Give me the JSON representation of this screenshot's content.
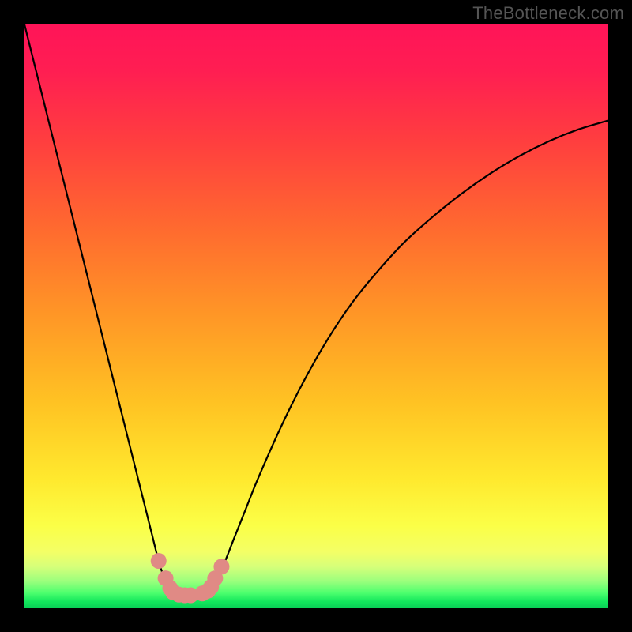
{
  "watermark": "TheBottleneck.com",
  "chart_data": {
    "type": "line",
    "title": "",
    "xlabel": "",
    "ylabel": "",
    "xlim": [
      0,
      100
    ],
    "ylim": [
      0,
      100
    ],
    "series": [
      {
        "name": "bottleneck-curve",
        "x": [
          0.0,
          2.0,
          4.0,
          6.0,
          8.0,
          10.0,
          12.0,
          14.0,
          16.0,
          18.0,
          19.0,
          20.0,
          21.0,
          22.0,
          23.0,
          24.0,
          25.0,
          26.0,
          27.0,
          28.0,
          29.0,
          30.0,
          32.0,
          34.0,
          36.0,
          38.0,
          40.0,
          44.0,
          48.0,
          52.0,
          56.0,
          60.0,
          65.0,
          70.0,
          75.0,
          80.0,
          85.0,
          90.0,
          95.0,
          100.0
        ],
        "y": [
          100.0,
          92.0,
          84.0,
          76.0,
          68.0,
          60.0,
          52.0,
          44.0,
          36.0,
          28.0,
          24.0,
          20.0,
          16.0,
          12.0,
          8.0,
          5.0,
          3.0,
          2.3,
          2.0,
          2.0,
          2.0,
          2.0,
          3.5,
          7.0,
          12.0,
          17.0,
          22.0,
          31.0,
          39.0,
          46.0,
          52.0,
          57.0,
          62.5,
          67.0,
          71.0,
          74.5,
          77.5,
          80.0,
          82.0,
          83.5
        ]
      }
    ],
    "markers": {
      "name": "highlight-dots",
      "x": [
        23.0,
        24.2,
        25.0,
        25.5,
        26.5,
        27.5,
        28.5,
        30.5,
        31.5,
        32.0,
        32.7,
        33.8
      ],
      "y": [
        8.0,
        5.0,
        3.3,
        2.6,
        2.2,
        2.1,
        2.1,
        2.4,
        2.9,
        3.5,
        5.0,
        7.0
      ],
      "color": "#e08a85",
      "radius": 10
    },
    "gradient_stops": [
      {
        "offset": 0.0,
        "color": "#ff1458"
      },
      {
        "offset": 0.08,
        "color": "#ff1e52"
      },
      {
        "offset": 0.2,
        "color": "#ff3e3f"
      },
      {
        "offset": 0.35,
        "color": "#ff6a2f"
      },
      {
        "offset": 0.5,
        "color": "#ff9726"
      },
      {
        "offset": 0.65,
        "color": "#ffc323"
      },
      {
        "offset": 0.78,
        "color": "#ffe92e"
      },
      {
        "offset": 0.86,
        "color": "#fbff47"
      },
      {
        "offset": 0.905,
        "color": "#f3ff66"
      },
      {
        "offset": 0.93,
        "color": "#d6ff7a"
      },
      {
        "offset": 0.955,
        "color": "#9bff7d"
      },
      {
        "offset": 0.975,
        "color": "#4dff6e"
      },
      {
        "offset": 0.99,
        "color": "#12e65c"
      },
      {
        "offset": 1.0,
        "color": "#0ad157"
      }
    ]
  }
}
